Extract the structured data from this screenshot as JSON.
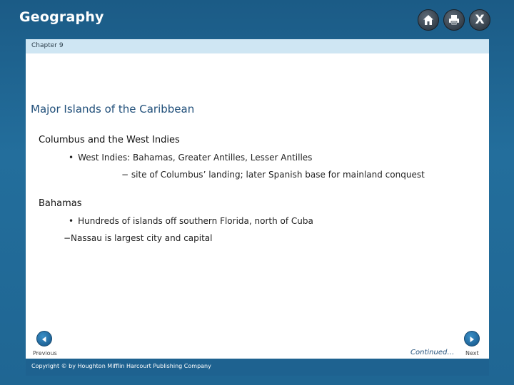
{
  "app": {
    "title": "Geography"
  },
  "toolbar": {
    "home_icon": "home-icon",
    "print_icon": "print-icon",
    "close_label": "X"
  },
  "slide": {
    "chapter": "Chapter 9",
    "heading": "Major Islands of the Caribbean",
    "sections": [
      {
        "title": "Columbus and the West Indies",
        "bullet": "West Indies: Bahamas, Greater Antilles, Lesser Antilles",
        "sub": "− site of Columbus’ landing; later Spanish base for mainland conquest"
      },
      {
        "title": "Bahamas",
        "bullet": "Hundreds of islands off southern Florida, north of Cuba",
        "sub": "−Nassau is largest city and capital"
      }
    ],
    "continued": "Continued…"
  },
  "nav": {
    "previous_label": "Previous",
    "next_label": "Next"
  },
  "footer": {
    "copyright": "Copyright © by Houghton Mifflin Harcourt Publishing Company"
  },
  "colors": {
    "frame": "#1d5f8a",
    "chapter_bar": "#cfe6f3",
    "heading": "#1f4e79",
    "nav_button": "#2a7ab5"
  }
}
